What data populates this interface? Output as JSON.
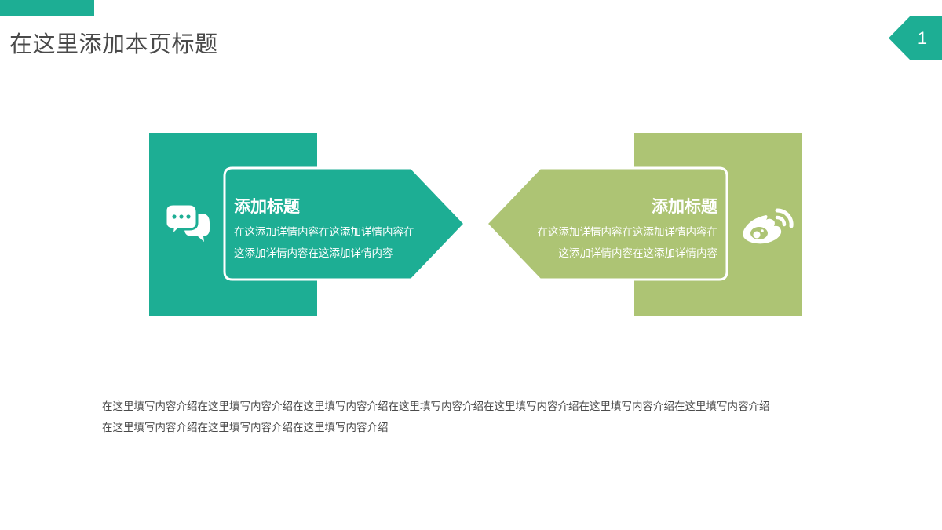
{
  "header": {
    "title": "在这里添加本页标题",
    "page_number": "1"
  },
  "cards": [
    {
      "title": "添加标题",
      "desc_line1": "在这添加详情内容在这添加详情内容在",
      "desc_line2": "这添加详情内容在这添加详情内容",
      "icon": "chat-bubbles-icon",
      "color": "#1dae94"
    },
    {
      "title": "添加标题",
      "desc_line1": "在这添加详情内容在这添加详情内容在",
      "desc_line2": "这添加详情内容在这添加详情内容",
      "icon": "weibo-icon",
      "color": "#adc474"
    }
  ],
  "body": {
    "line1": "在这里填写内容介绍在这里填写内容介绍在这里填写内容介绍在这里填写内容介绍在这里填写内容介绍在这里填写内容介绍在这里填写内容介绍",
    "line2": "在这里填写内容介绍在这里填写内容介绍在这里填写内容介绍"
  },
  "colors": {
    "primary": "#1dae94",
    "secondary": "#adc474",
    "title_text": "#4a4a4a"
  }
}
